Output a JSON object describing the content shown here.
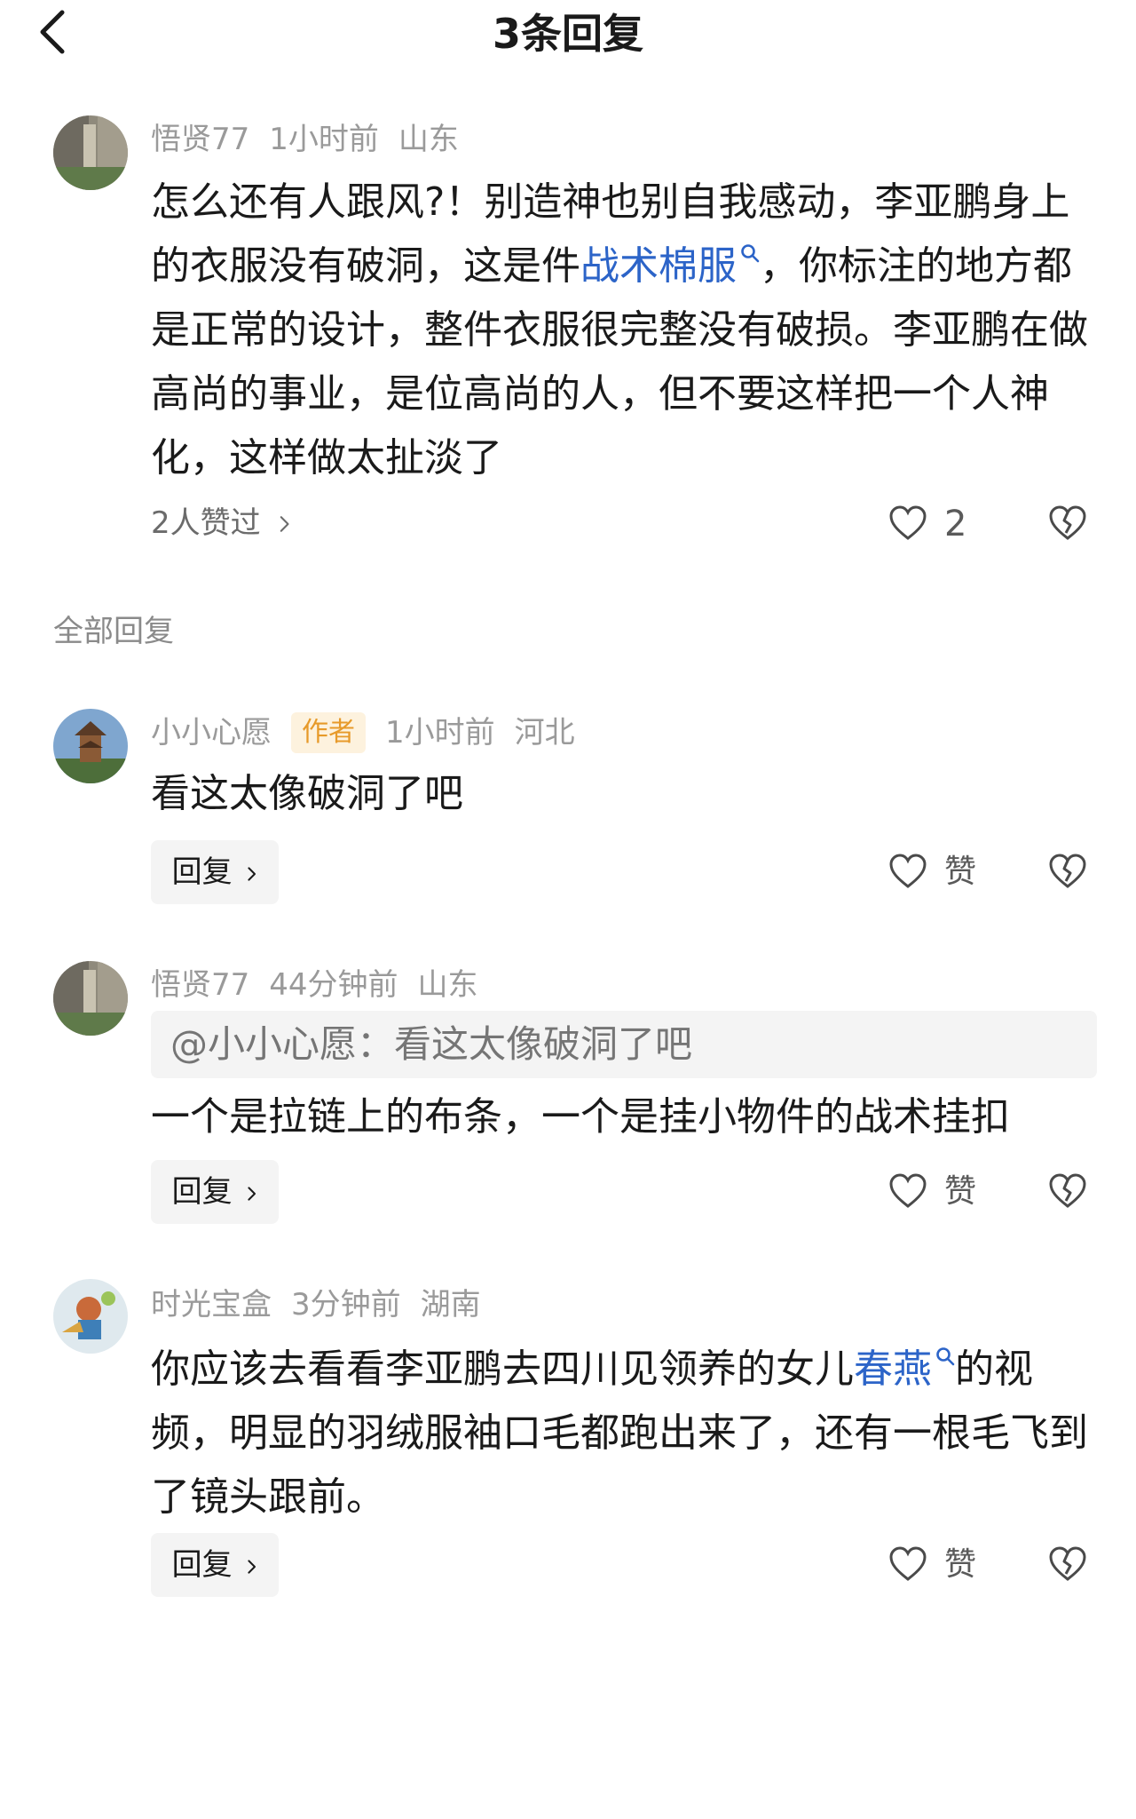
{
  "header": {
    "title": "3条回复"
  },
  "main_comment": {
    "user": "悟贤77",
    "time": "1小时前",
    "location": "山东",
    "text_part1": "怎么还有人跟风?！别造神也别自我感动，李亚鹏身上的衣服没有破洞，这是件",
    "link": "战术棉服",
    "text_part2": "，你标注的地方都是正常的设计，整件衣服很完整没有破损。李亚鹏在做高尚的事业，是位高尚的人，但不要这样把一个人神化，这样做太扯淡了",
    "likes_summary": "2人赞过",
    "like_count": "2"
  },
  "section_label": "全部回复",
  "replies": [
    {
      "user": "小小心愿",
      "badge": "作者",
      "time": "1小时前",
      "location": "河北",
      "text": "看这太像破洞了吧",
      "reply_label": "回复",
      "like_label": "赞"
    },
    {
      "user": "悟贤77",
      "time": "44分钟前",
      "location": "山东",
      "quote": "@小小心愿：看这太像破洞了吧",
      "text": "一个是拉链上的布条，一个是挂小物件的战术挂扣",
      "reply_label": "回复",
      "like_label": "赞"
    },
    {
      "user": "时光宝盒",
      "time": "3分钟前",
      "location": "湖南",
      "text_part1": "你应该去看看李亚鹏去四川见领养的女儿",
      "link": "春燕",
      "text_part2": "的视频，明显的羽绒服袖口毛都跑出来了，还有一根毛飞到了镜头跟前。",
      "reply_label": "回复",
      "like_label": "赞"
    }
  ],
  "icons": {
    "back": "chevron-left-icon",
    "like": "heart-outline-icon",
    "dislike": "broken-heart-icon",
    "search": "magnifier-icon",
    "arrow": "chevron-right-icon"
  },
  "colors": {
    "link": "#2c64c8",
    "badge_bg": "#fdf2de",
    "badge_text": "#e79a2a",
    "meta": "#9a9a9a"
  }
}
